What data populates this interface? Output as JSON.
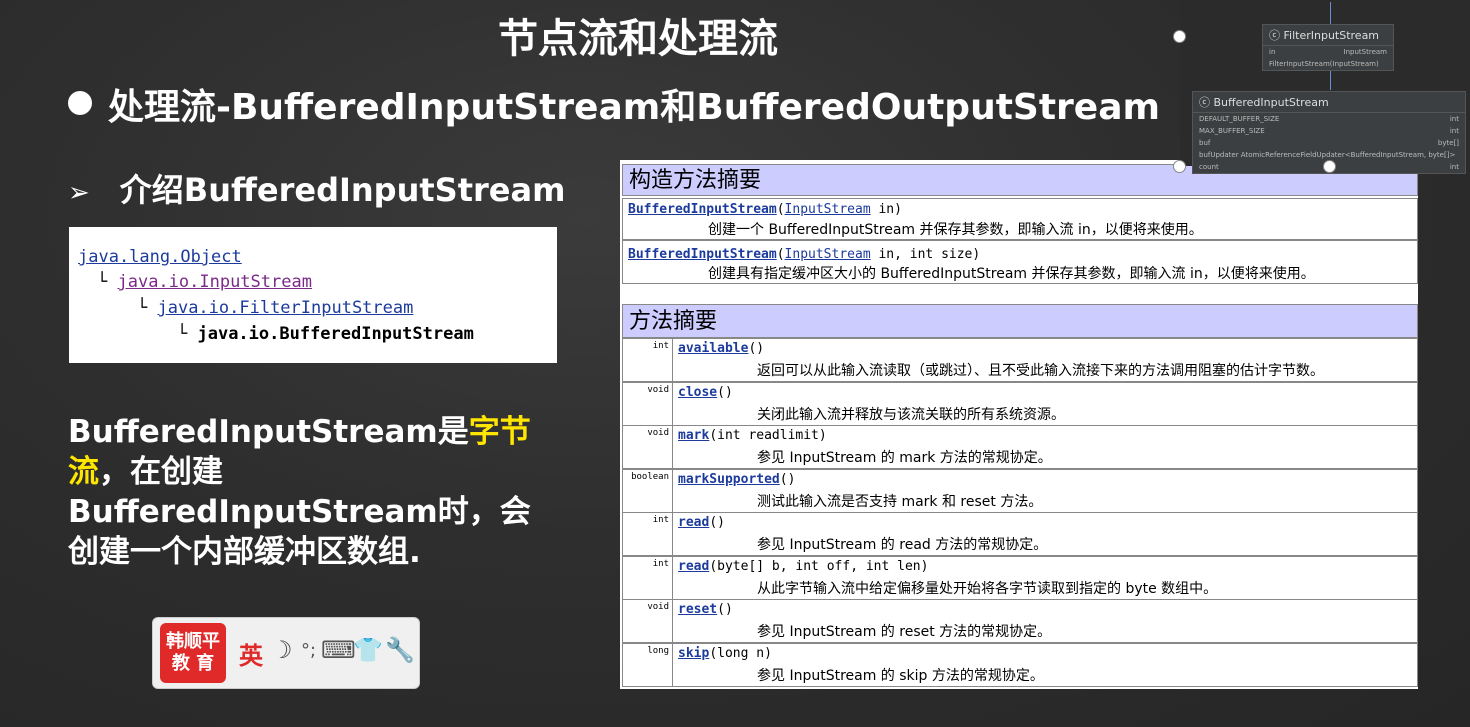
{
  "title": "节点流和处理流",
  "heading1": "处理流-BufferedInputStream和BufferedOutputStream",
  "heading2": "介绍BufferedInputStream",
  "hierarchy": {
    "lines": [
      "java.lang.Object",
      "java.io.InputStream",
      "java.io.FilterInputStream",
      "java.io.BufferedInputStream"
    ]
  },
  "description": {
    "part1": "BufferedInputStream是",
    "highlight": "字节流",
    "part2": "，在创建 BufferedInputStream时，会创建一个内部缓冲区数组."
  },
  "constructor_summary": {
    "title": "构造方法摘要",
    "rows": [
      {
        "name": "BufferedInputStream",
        "param_type": "InputStream",
        "rest": " in)",
        "desc": "创建一个 BufferedInputStream 并保存其参数，即输入流 in，以便将来使用。"
      },
      {
        "name": "BufferedInputStream",
        "param_type": "InputStream",
        "rest": " in, int size)",
        "desc": "创建具有指定缓冲区大小的 BufferedInputStream 并保存其参数，即输入流 in，以便将来使用。"
      }
    ]
  },
  "method_summary": {
    "title": "方法摘要",
    "rows": [
      {
        "type": "int",
        "name": "available",
        "params": "()",
        "desc": "返回可以从此输入流读取（或跳过）、且不受此输入流接下来的方法调用阻塞的估计字节数。"
      },
      {
        "type": "void",
        "name": "close",
        "params": "()",
        "desc": "关闭此输入流并释放与该流关联的所有系统资源。"
      },
      {
        "type": "void",
        "name": "mark",
        "params": "(int readlimit)",
        "desc": "参见 InputStream 的 mark 方法的常规协定。"
      },
      {
        "type": "boolean",
        "name": "markSupported",
        "params": "()",
        "desc": "测试此输入流是否支持 mark 和 reset 方法。"
      },
      {
        "type": "int",
        "name": "read",
        "params": "()",
        "desc": "参见 InputStream 的 read 方法的常规协定。"
      },
      {
        "type": "int",
        "name": "read",
        "params": "(byte[] b, int off, int len)",
        "desc": "从此字节输入流中给定偏移量处开始将各字节读取到指定的 byte 数组中。"
      },
      {
        "type": "void",
        "name": "reset",
        "params": "()",
        "desc": "参见 InputStream 的 reset 方法的常规协定。"
      },
      {
        "type": "long",
        "name": "skip",
        "params": "(long n)",
        "desc": "参见 InputStream 的 skip 方法的常规协定。"
      }
    ]
  },
  "logo": {
    "line1": "韩顺平",
    "line2": "教 育"
  },
  "ime": {
    "lang": "英",
    "moon_icon": "moon-icon",
    "punct": "°;",
    "keyboard_icon": "keyboard-icon",
    "shirt_icon": "shirt-icon",
    "wrench_icon": "wrench-icon"
  },
  "diagram": {
    "filter_box": {
      "title": "FilterInputStream",
      "rows": [
        [
          "in",
          "InputStream"
        ],
        [
          "FilterInputStream(InputStream)",
          ""
        ]
      ]
    },
    "buffered_box": {
      "title": "BufferedInputStream",
      "rows": [
        [
          "DEFAULT_BUFFER_SIZE",
          "int"
        ],
        [
          "MAX_BUFFER_SIZE",
          "int"
        ],
        [
          "buf",
          "byte[]"
        ],
        [
          "bufUpdater  AtomicReferenceFieldUpdater<BufferedInputStream, byte[]>",
          ""
        ],
        [
          "count",
          "int"
        ]
      ]
    }
  },
  "colors": {
    "highlight": "#ffe600",
    "link": "#1c3b9c",
    "section_bg": "#ccccff"
  }
}
